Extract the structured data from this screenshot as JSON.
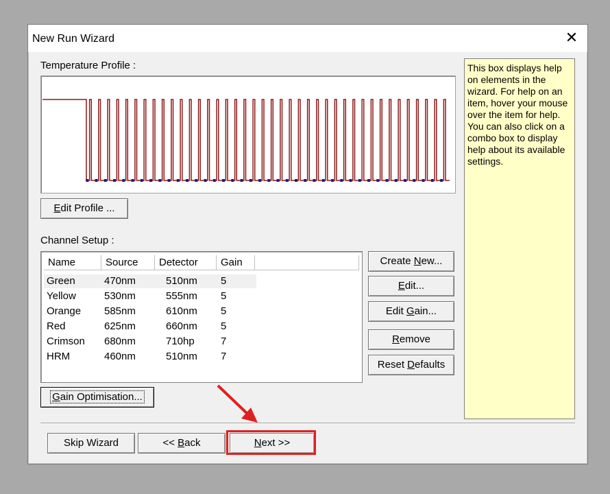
{
  "window": {
    "title": "New Run Wizard",
    "close_glyph": "✕"
  },
  "temperature": {
    "label": "Temperature Profile :",
    "edit_button": {
      "prefix": "",
      "underlined": "E",
      "rest": "dit Profile ..."
    }
  },
  "channel_setup": {
    "label": "Channel Setup :",
    "columns": [
      "Name",
      "Source",
      "Detector",
      "Gain"
    ],
    "rows": [
      [
        "Green",
        "470nm",
        "510nm",
        "5"
      ],
      [
        "Yellow",
        "530nm",
        "555nm",
        "5"
      ],
      [
        "Orange",
        "585nm",
        "610nm",
        "5"
      ],
      [
        "Red",
        "625nm",
        "660nm",
        "5"
      ],
      [
        "Crimson",
        "680nm",
        "710hp",
        "7"
      ],
      [
        "HRM",
        "460nm",
        "510nm",
        "7"
      ]
    ]
  },
  "side_buttons": {
    "create_new": {
      "prefix": "Create ",
      "underlined": "N",
      "rest": "ew..."
    },
    "edit": {
      "prefix": "",
      "underlined": "E",
      "rest": "dit..."
    },
    "edit_gain": {
      "prefix": "Edit ",
      "underlined": "G",
      "rest": "ain..."
    },
    "remove": {
      "prefix": "",
      "underlined": "R",
      "rest": "emove"
    },
    "reset_defaults": {
      "prefix": "Reset ",
      "underlined": "D",
      "rest": "efaults"
    }
  },
  "gain_optimisation": {
    "prefix": "",
    "underlined": "G",
    "rest": "ain Optimisation..."
  },
  "help_text": "This box displays help on elements in the wizard. For help on an item, hover your mouse over the item for help. You can also click on a combo box to display help about its available settings.",
  "footer": {
    "skip": "Skip Wizard",
    "back": {
      "prefix": "<< ",
      "underlined": "B",
      "rest": "ack"
    },
    "next": {
      "prefix": "",
      "underlined": "N",
      "rest": "ext >>"
    }
  },
  "colors": {
    "profile_line": "#8b1a1a",
    "marker": "#1a1a8b",
    "help_bg": "#ffffc8",
    "highlight": "#e02020"
  },
  "profile_cycles": 40
}
